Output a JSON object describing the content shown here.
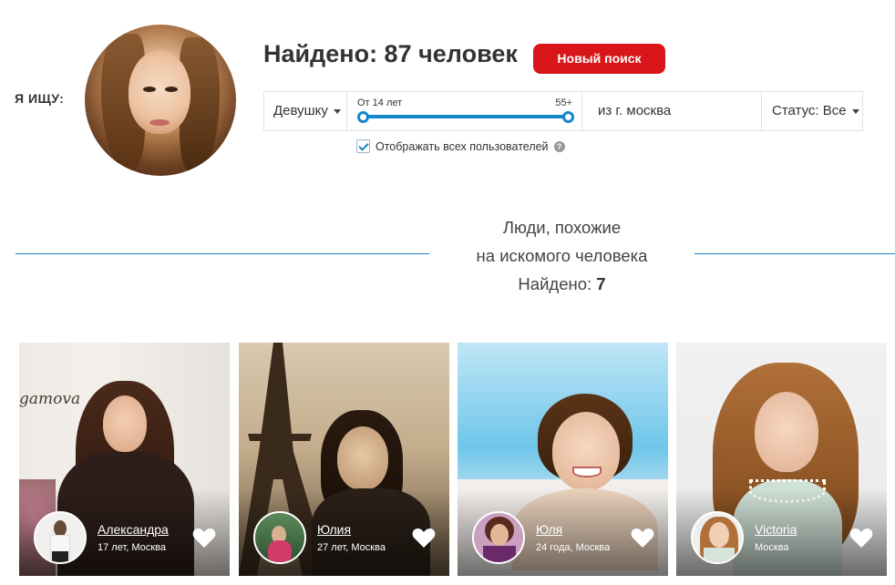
{
  "search": {
    "seeking_label": "Я ИЩУ:",
    "found_title": "Найдено: 87 человек",
    "new_search_label": "Новый поиск",
    "gender_value": "Девушку",
    "age_from_label": "От 14 лет",
    "age_to_label": "55+",
    "age_range_fraction": [
      0,
      1
    ],
    "city_value": "из г. москва",
    "status_value": "Статус: Все",
    "show_all_label": "Отображать всех пользователей",
    "show_all_checked": true
  },
  "similar": {
    "line1": "Люди, похожие",
    "line2": "на искомого человека",
    "count_label": "Найдено:",
    "count": "7"
  },
  "cards": [
    {
      "name": "Александра",
      "meta": "17 лет, Москва",
      "photo_text": "gamova"
    },
    {
      "name": "Юлия",
      "meta": "27 лет, Москва"
    },
    {
      "name": "Юля",
      "meta": "24 года, Москва"
    },
    {
      "name": "Victoria",
      "meta": "Москва"
    }
  ],
  "colors": {
    "accent_blue": "#1487c9",
    "button_red": "#d8161a"
  },
  "icons": {
    "dropdown": "caret-down-icon",
    "help": "question-circle-icon",
    "favorite": "heart-icon",
    "checkbox": "checkmark-icon"
  }
}
